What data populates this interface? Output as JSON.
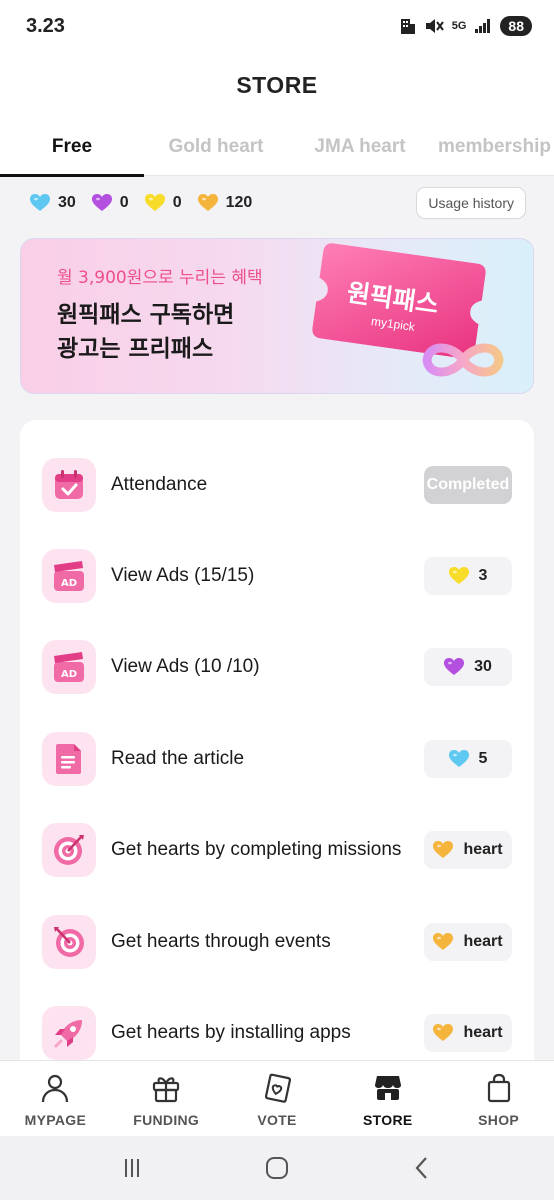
{
  "status_bar": {
    "time": "3.23",
    "battery": "88",
    "network": "5G"
  },
  "header": {
    "title": "STORE"
  },
  "tabs": [
    {
      "label": "Free",
      "active": true
    },
    {
      "label": "Gold heart",
      "active": false
    },
    {
      "label": "JMA heart",
      "active": false
    },
    {
      "label": "membership",
      "active": false
    }
  ],
  "balances": [
    {
      "icon": "blue-heart-icon",
      "color": "#5ec8f0",
      "value": "30"
    },
    {
      "icon": "purple-heart-icon",
      "color": "#b44fe0",
      "value": "0"
    },
    {
      "icon": "yellow-heart-icon",
      "color": "#f8dc2a",
      "value": "0"
    },
    {
      "icon": "gold-heart-icon",
      "color": "#f5b53c",
      "value": "120"
    }
  ],
  "usage_history_label": "Usage history",
  "banner": {
    "subtitle": "월 3,900원으로 누리는 혜택",
    "line1": "원픽패스 구독하면",
    "line2": "광고는 프리패스",
    "ticket_text": "원픽패스",
    "ticket_brand": "my1pick"
  },
  "tasks": [
    {
      "label": "Attendance",
      "icon": "calendar-check-icon",
      "reward": "Completed",
      "completed": true
    },
    {
      "label": "View Ads (15/15)",
      "icon": "ad-clapper-icon",
      "reward": "3",
      "reward_icon": "yellow-heart-icon"
    },
    {
      "label": "View Ads (10 /10)",
      "icon": "ad-clapper-icon",
      "reward": "30",
      "reward_icon": "purple-heart-icon"
    },
    {
      "label": "Read the article",
      "icon": "document-icon",
      "reward": "5",
      "reward_icon": "blue-heart-icon"
    },
    {
      "label": "Get hearts by completing missions",
      "icon": "target-icon",
      "reward": "heart",
      "reward_icon": "gold-heart-icon"
    },
    {
      "label": "Get hearts through events",
      "icon": "target-icon",
      "reward": "heart",
      "reward_icon": "gold-heart-icon"
    },
    {
      "label": "Get hearts by installing apps",
      "icon": "rocket-icon",
      "reward": "heart",
      "reward_icon": "gold-heart-icon"
    }
  ],
  "bottom_nav": [
    {
      "label": "MYPAGE",
      "icon": "person-icon"
    },
    {
      "label": "FUNDING",
      "icon": "gift-icon"
    },
    {
      "label": "VOTE",
      "icon": "vote-card-icon"
    },
    {
      "label": "STORE",
      "icon": "store-icon",
      "active": true
    },
    {
      "label": "SHOP",
      "icon": "shopping-bag-icon"
    }
  ],
  "colors": {
    "accent_pink": "#ee4f8a",
    "icon_bg": "#fde3f0",
    "active_text": "#111111"
  }
}
